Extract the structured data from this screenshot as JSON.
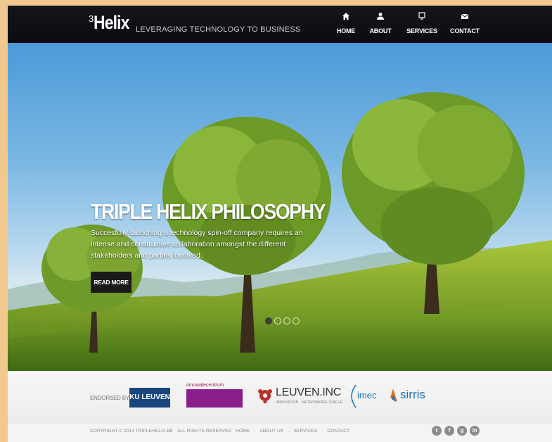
{
  "header": {
    "logo_sup": "3",
    "logo_main": "Helix",
    "tagline": "LEVERAGING TECHNOLOGY TO BUSINESS",
    "nav": [
      {
        "label": "HOME",
        "icon": "home-icon"
      },
      {
        "label": "ABOUT",
        "icon": "user-icon"
      },
      {
        "label": "SERVICES",
        "icon": "services-icon"
      },
      {
        "label": "CONTACT",
        "icon": "envelope-icon"
      }
    ]
  },
  "hero": {
    "title": "TRIPLE HELIX PHILOSOPHY",
    "text": "Succesfully launching a technology spin-off company requires an intense and constructive collaboration amongst the different stakeholders and parties involved.",
    "button": "READ MORE",
    "slides_total": 4,
    "slide_active": 1
  },
  "endorsers": {
    "label": "ENDORSED BY",
    "ku": "KU LEUVEN",
    "innov": "innovatiecentrum",
    "leuven": "LEUVEN.INC",
    "leuven_sub": "INNOVATION · NETWORKING CIRCLE",
    "imec": "imec",
    "sirris": "sirris"
  },
  "footer": {
    "copyright": "COPYRIGHT © 2013 TRIPLEHELIX.BE",
    "rights": "ALL RIGHTS RESERVED",
    "links": [
      "HOME",
      "ABOUT US",
      "SERVICES",
      "CONTACT"
    ],
    "social": [
      "twitter-icon",
      "facebook-icon",
      "google-plus-icon",
      "linkedin-icon"
    ]
  },
  "colors": {
    "frame_bg": "#f1c98f",
    "header_bg": "#0e0f13",
    "ku_blue": "#1a4680",
    "innov_purple": "#8a1e8c",
    "link_blue": "#1d75b8"
  }
}
